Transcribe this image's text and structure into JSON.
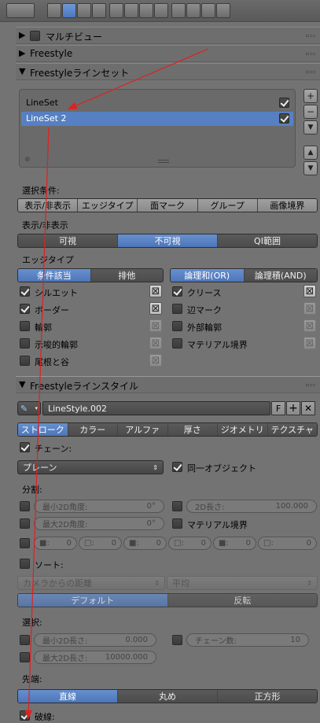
{
  "header": {
    "icons": [
      "render-icon",
      "render-layers-icon",
      "scene-icon",
      "world-icon",
      "object-icon",
      "constraints-icon",
      "modifiers-icon",
      "data-icon",
      "material-icon",
      "texture-icon",
      "particles-icon",
      "physics-icon"
    ]
  },
  "panels": {
    "multiview": "マルチビュー",
    "freestyle": "Freestyle",
    "lineset_panel": "Freestyleラインセット",
    "linestyle_panel": "Freestyleラインスタイル"
  },
  "lineset": {
    "items": [
      {
        "name": "LineSet",
        "checked": true
      },
      {
        "name": "LineSet 2",
        "checked": true
      }
    ]
  },
  "selection": {
    "label": "選択条件:",
    "tabs": [
      "表示/非表示",
      "エッジタイプ",
      "面マーク",
      "グループ",
      "画像境界"
    ]
  },
  "visibility": {
    "label": "表示/非表示",
    "options": [
      "可視",
      "不可視",
      "QI範囲"
    ]
  },
  "edge": {
    "label": "エッジタイプ",
    "cond": [
      "条件該当",
      "排他"
    ],
    "logic": [
      "論理和(OR)",
      "論理積(AND)"
    ],
    "left": [
      "シルエット",
      "ボーダー",
      "輪郭",
      "示唆的輪郭",
      "尾根と谷"
    ],
    "right": [
      "クリース",
      "辺マーク",
      "外部輪郭",
      "マテリアル境界"
    ]
  },
  "linestyle": {
    "name": "LineStyle.002",
    "fake": "F",
    "tabs": [
      "ストローク",
      "カラー",
      "アルファ",
      "厚さ",
      "ジオメトリ",
      "テクスチャ"
    ],
    "chain_label": "チェーン:",
    "chain_type": "プレーン",
    "same_object": "同一オブジェクト",
    "split_label": "分割:",
    "min2d_angle": "最小2D角度:",
    "min2d_angle_val": "0°",
    "max2d_angle": "最大2D角度:",
    "max2d_angle_val": "0°",
    "len2d": "2D長さ:",
    "len2d_val": "100.000",
    "material_boundary": "マテリアル境界",
    "dash_vals": [
      "0",
      "0",
      "0",
      "0",
      "0",
      "0"
    ],
    "dash_labels": [
      "■:",
      "□:",
      "■:",
      "□:",
      "■:",
      "□:"
    ],
    "sort_label": "ソート:",
    "sort_key": "カメラからの距離",
    "sort_fn": "平均",
    "sort_order": [
      "デフォルト",
      "反転"
    ],
    "select_label": "選択:",
    "min2d_len": "最小2D長さ:",
    "min2d_len_val": "0.000",
    "chain_count": "チェーン数:",
    "chain_count_val": "10",
    "max2d_len": "最大2D長さ:",
    "max2d_len_val": "10000.000",
    "caps_label": "先端:",
    "caps": [
      "直線",
      "丸め",
      "正方形"
    ],
    "dashed_label": "破線:"
  },
  "colors": {
    "accent": "#5680c2",
    "annotation": "#e02020"
  }
}
